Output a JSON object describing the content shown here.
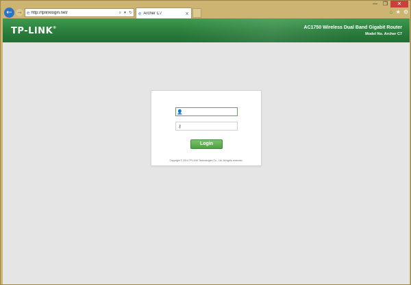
{
  "browser": {
    "url": "http://tplinklogin.net/",
    "tab_title": "Archer C7",
    "icons": [
      "back-icon",
      "forward-icon",
      "ie-icon",
      "search-icon",
      "refresh-icon",
      "close-icon",
      "home-icon",
      "star-icon",
      "gear-icon"
    ]
  },
  "window_controls": {
    "minimize": "—",
    "restore": "❐",
    "close": "✕"
  },
  "header": {
    "logo": "TP-LINK",
    "product": "AC1750 Wireless Dual Band Gigabit Router",
    "model": "Model No. Archer C7"
  },
  "login": {
    "username_placeholder": "",
    "password_placeholder": "",
    "button_label": "Login",
    "copyright": "Copyright © 2014 TP-LINK Technologies Co., Ltd. All rights reserved."
  },
  "colors": {
    "brand_green": "#2b7e3c",
    "button_green": "#4fa043",
    "window_frame": "#cdb472",
    "page_bg": "#e5e5e5"
  }
}
